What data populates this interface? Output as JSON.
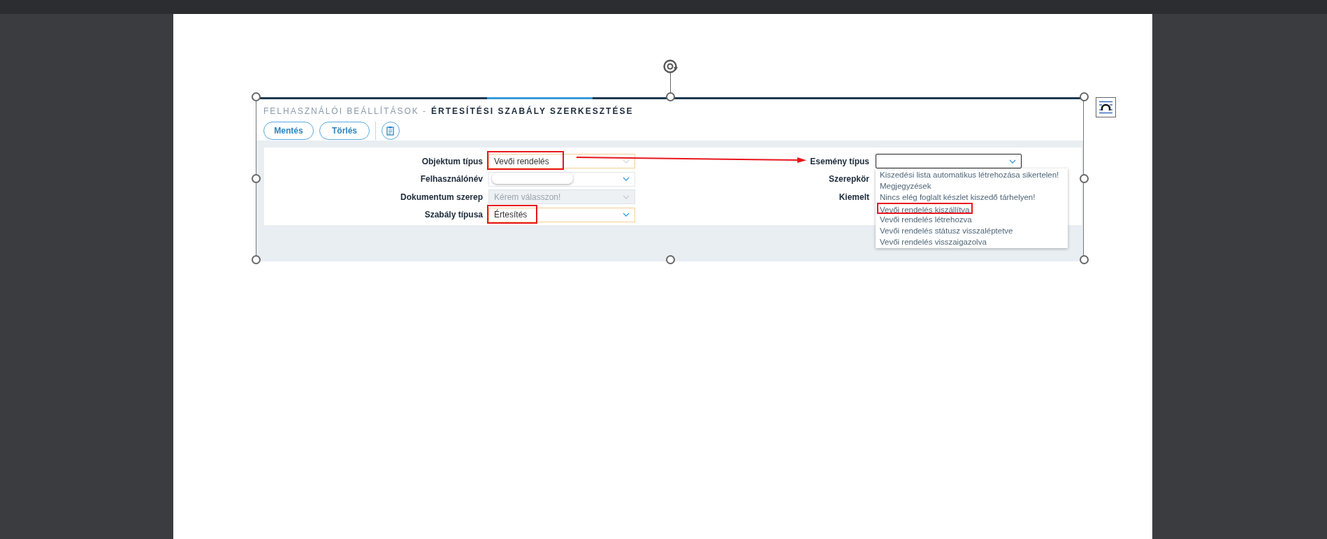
{
  "screenshot": {
    "breadcrumb": "FELHASZNÁLÓI BEÁLLÍTÁSOK -",
    "title": "ÉRTESÍTÉSI SZABÁLY SZERKESZTÉSE",
    "buttons": [
      "Mentés",
      "Törlés"
    ],
    "left_fields": [
      {
        "label": "Objektum típus",
        "value": "Vevői rendelés",
        "highlighted": true,
        "disabled": false,
        "annotated": true
      },
      {
        "label": "Felhasználónév",
        "highlighted": false,
        "disabled": false,
        "annotated": false
      },
      {
        "label": "Dokumentum szerep",
        "placeholder": "Kérem válasszon!",
        "highlighted": false,
        "disabled": true,
        "annotated": false
      },
      {
        "label": "Szabály típusa",
        "value": "Értesítés",
        "highlighted": true,
        "disabled": false,
        "annotated": true
      }
    ],
    "right_fields": [
      {
        "label": "Esemény típus",
        "expanded": true
      },
      {
        "label": "Szerepkör",
        "expanded": false
      },
      {
        "label": "Kiemelt",
        "expanded": false
      }
    ],
    "dropdown_options": [
      {
        "label": "Kiszedési lista automatikus létrehozása sikertelen!",
        "annotated": false
      },
      {
        "label": "Megjegyzések",
        "annotated": false
      },
      {
        "label": "Nincs elég foglalt készlet kiszedő tárhelyen!",
        "annotated": false
      },
      {
        "label": "Vevői rendelés kiszállítva",
        "annotated": true
      },
      {
        "label": "Vevői rendelés létrehozva",
        "annotated": false
      },
      {
        "label": "Vevői rendelés státusz visszaléptetve",
        "annotated": false
      },
      {
        "label": "Vevői rendelés visszaigazolva",
        "annotated": false
      }
    ]
  }
}
